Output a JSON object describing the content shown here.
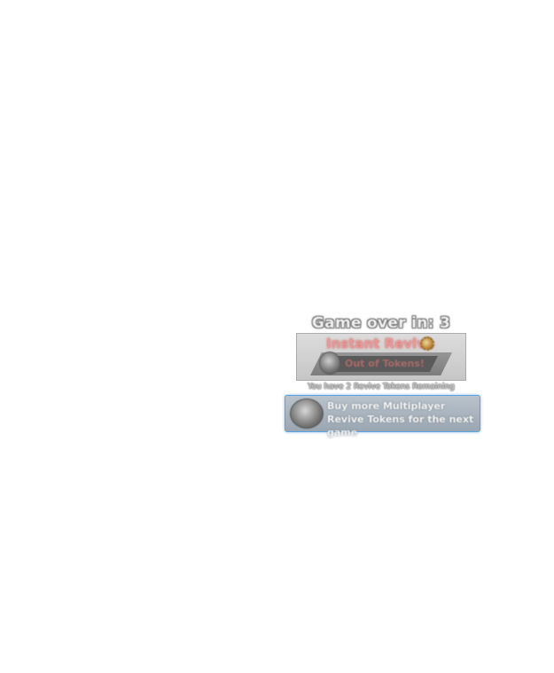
{
  "game_over": {
    "label": "Game over in: 3"
  },
  "instant_revive": {
    "title": "Instant Revive",
    "status": "Out of Tokens!",
    "tokens_remaining_text": "You have 2 Revive Tokens Remaining"
  },
  "buy_button": {
    "label": "Buy more Multiplayer Revive Tokens for the next game"
  },
  "icons": {
    "badge": "badge-icon",
    "token": "revive-token-icon"
  },
  "colors": {
    "button_border": "#5aa3e0",
    "revive_title": "#e59a9a"
  }
}
